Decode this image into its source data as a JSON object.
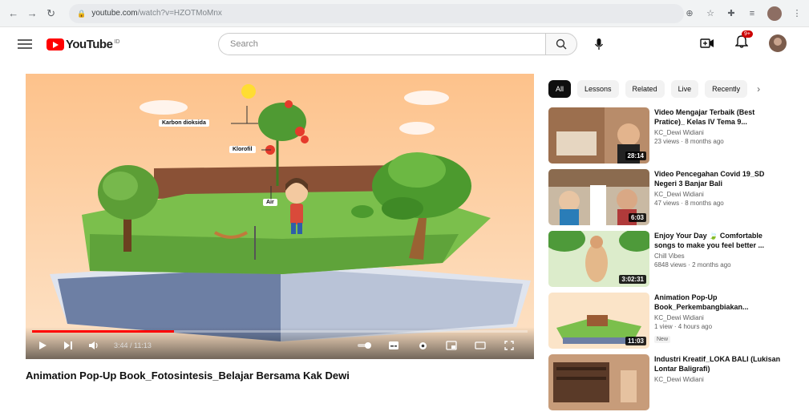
{
  "browser": {
    "url_main": "youtube.com",
    "url_rest": "/watch?v=HZOTMoMnx",
    "tab_count": ""
  },
  "header": {
    "logo_text": "YouTube",
    "logo_sup": "ID",
    "search_placeholder": "Search",
    "notification_count": "9+"
  },
  "player": {
    "scene_labels": {
      "co2": "Karbon dioksida",
      "chlorophyll": "Klorofil",
      "water": "Air"
    },
    "time": "3:44 / 11:13",
    "progress": 0.286
  },
  "video": {
    "title": "Animation Pop-Up Book_Fotosintesis_Belajar Bersama Kak Dewi"
  },
  "sidebar": {
    "chips": [
      "All",
      "Lessons",
      "Related",
      "Live",
      "Recently"
    ],
    "recommendations": [
      {
        "title": "Video Mengajar Terbaik (Best Pratice)_ Kelas IV Tema 9...",
        "channel": "KC_Dewi Widiani",
        "meta": "23 views · 8 months ago",
        "duration": "28:14"
      },
      {
        "title": "Video Pencegahan Covid 19_SD Negeri 3 Banjar Bali",
        "channel": "KC_Dewi Widiani",
        "meta": "47 views · 8 months ago",
        "duration": "6:03"
      },
      {
        "title": "Enjoy Your Day 🍃 Comfortable songs to make you feel better ...",
        "channel": "Chill Vibes",
        "meta": "6848 views · 2 months ago",
        "duration": "3:02:31"
      },
      {
        "title": "Animation Pop-Up Book_Perkembangbiakan...",
        "channel": "KC_Dewi Widiani",
        "meta": "1 view · 4 hours ago",
        "duration": "11:03",
        "badge": "New"
      },
      {
        "title": "Industri Kreatif_LOKA BALI (Lukisan Lontar Baligrafi)",
        "channel": "KC_Dewi Widiani",
        "meta": "",
        "duration": ""
      }
    ]
  }
}
